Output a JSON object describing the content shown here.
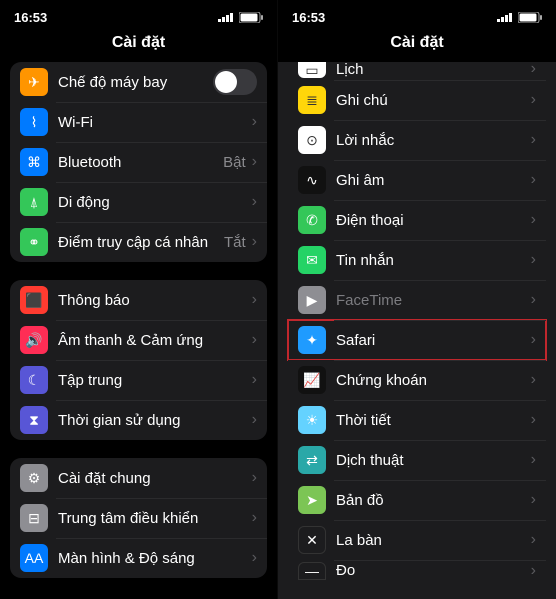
{
  "status": {
    "time": "16:53"
  },
  "title": "Cài đặt",
  "left": {
    "groups": [
      [
        {
          "name": "airplane-mode",
          "icon": "airplane-icon",
          "iconBg": "bg-orange",
          "label": "Chế độ máy bay",
          "switch": true
        },
        {
          "name": "wifi",
          "icon": "wifi-icon",
          "iconBg": "bg-blue",
          "label": "Wi-Fi",
          "chevron": true
        },
        {
          "name": "bluetooth",
          "icon": "bluetooth-icon",
          "iconBg": "bg-blue",
          "label": "Bluetooth",
          "detail": "Bật",
          "chevron": true
        },
        {
          "name": "cellular",
          "icon": "antenna-icon",
          "iconBg": "bg-green",
          "label": "Di động",
          "chevron": true
        },
        {
          "name": "hotspot",
          "icon": "link-icon",
          "iconBg": "bg-green",
          "label": "Điểm truy cập cá nhân",
          "detail": "Tắt",
          "chevron": true
        }
      ],
      [
        {
          "name": "notifications",
          "icon": "bell-icon",
          "iconBg": "bg-red",
          "label": "Thông báo",
          "chevron": true
        },
        {
          "name": "sounds",
          "icon": "speaker-icon",
          "iconBg": "bg-pink",
          "label": "Âm thanh & Cảm ứng",
          "chevron": true
        },
        {
          "name": "focus",
          "icon": "moon-icon",
          "iconBg": "bg-purple",
          "label": "Tập trung",
          "chevron": true
        },
        {
          "name": "screentime",
          "icon": "hourglass-icon",
          "iconBg": "bg-purple",
          "label": "Thời gian sử dụng",
          "chevron": true
        }
      ],
      [
        {
          "name": "general",
          "icon": "gear-icon",
          "iconBg": "bg-grey",
          "label": "Cài đặt chung",
          "chevron": true
        },
        {
          "name": "control-center",
          "icon": "switches-icon",
          "iconBg": "bg-grey",
          "label": "Trung tâm điều khiển",
          "chevron": true
        },
        {
          "name": "display",
          "icon": "text-icon",
          "iconBg": "bg-blue",
          "label": "Màn hình & Độ sáng",
          "chevron": true
        }
      ]
    ]
  },
  "right": {
    "rows": [
      {
        "name": "calendar",
        "icon": "calendar-icon",
        "iconBg": "bg-white",
        "label": "Lịch",
        "chevron": true,
        "clipped": "top"
      },
      {
        "name": "notes",
        "icon": "notes-icon",
        "iconBg": "bg-yellow",
        "label": "Ghi chú",
        "chevron": true
      },
      {
        "name": "reminders",
        "icon": "reminders-icon",
        "iconBg": "bg-white",
        "label": "Lời nhắc",
        "chevron": true
      },
      {
        "name": "voice-memos",
        "icon": "voicememo-icon",
        "iconBg": "bg-black",
        "label": "Ghi âm",
        "chevron": true
      },
      {
        "name": "phone",
        "icon": "phone-icon",
        "iconBg": "bg-green",
        "label": "Điện thoại",
        "chevron": true
      },
      {
        "name": "messages",
        "icon": "messages-icon",
        "iconBg": "bg-dgreen",
        "label": "Tin nhắn",
        "chevron": true
      },
      {
        "name": "facetime",
        "icon": "facetime-icon",
        "iconBg": "bg-grey",
        "label": "FaceTime",
        "dim": true,
        "chevron": true
      },
      {
        "name": "safari",
        "icon": "safari-icon",
        "iconBg": "bg-safari",
        "label": "Safari",
        "chevron": true,
        "highlight": true
      },
      {
        "name": "stocks",
        "icon": "stocks-icon",
        "iconBg": "bg-black",
        "label": "Chứng khoán",
        "chevron": true
      },
      {
        "name": "weather",
        "icon": "weather-icon",
        "iconBg": "bg-cyan",
        "label": "Thời tiết",
        "chevron": true
      },
      {
        "name": "translate",
        "icon": "translate-icon",
        "iconBg": "bg-teal",
        "label": "Dịch thuật",
        "chevron": true
      },
      {
        "name": "maps",
        "icon": "maps-icon",
        "iconBg": "bg-maps",
        "label": "Bản đồ",
        "chevron": true
      },
      {
        "name": "compass",
        "icon": "compass-icon",
        "iconBg": "bg-compass",
        "label": "La bàn",
        "chevron": true
      },
      {
        "name": "measure",
        "icon": "ruler-icon",
        "iconBg": "bg-ruler",
        "label": "Đo",
        "chevron": true,
        "clipped": "bot"
      }
    ]
  },
  "icons": {
    "airplane-icon": "✈",
    "wifi-icon": "⌇",
    "bluetooth-icon": "⌘",
    "antenna-icon": "⍋",
    "link-icon": "⚭",
    "bell-icon": "⬛",
    "speaker-icon": "🔊",
    "moon-icon": "☾",
    "hourglass-icon": "⧗",
    "gear-icon": "⚙",
    "switches-icon": "⊟",
    "text-icon": "AA",
    "calendar-icon": "▭",
    "notes-icon": "≣",
    "reminders-icon": "⊙",
    "voicememo-icon": "∿",
    "phone-icon": "✆",
    "messages-icon": "✉",
    "facetime-icon": "▶",
    "safari-icon": "✦",
    "stocks-icon": "📈",
    "weather-icon": "☀",
    "translate-icon": "⇄",
    "maps-icon": "➤",
    "compass-icon": "✕",
    "ruler-icon": "—"
  }
}
